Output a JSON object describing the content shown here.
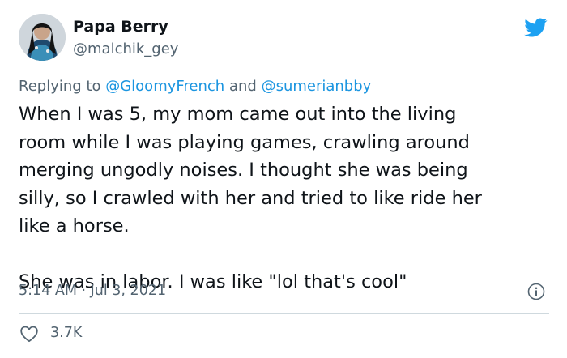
{
  "author": {
    "display_name": "Papa Berry",
    "handle": "@malchik_gey",
    "avatar_icon": "profile-photo"
  },
  "reply": {
    "prefix": "Replying to",
    "mention1": "@GloomyFrench",
    "joiner": "and",
    "mention2": "@sumerianbby"
  },
  "body": {
    "lines": [
      "When I was 5, my mom came out into the living",
      "room while I was playing games, crawling around",
      "merging ungodly noises. I thought she was being",
      "silly, so I crawled with her and tried to like ride her",
      "like a horse."
    ],
    "closing": "She was in labor. I was like \"lol that's cool\""
  },
  "meta": {
    "timestamp": "5:14 AM · Jul 3, 2021",
    "info_icon": "info-icon"
  },
  "actions": {
    "like_icon": "heart-icon",
    "like_count": "3.7K"
  },
  "colors": {
    "brand": "#1da1f2",
    "link": "#1b95e0",
    "secondary_text": "#536471",
    "divider": "#cfd9de"
  }
}
